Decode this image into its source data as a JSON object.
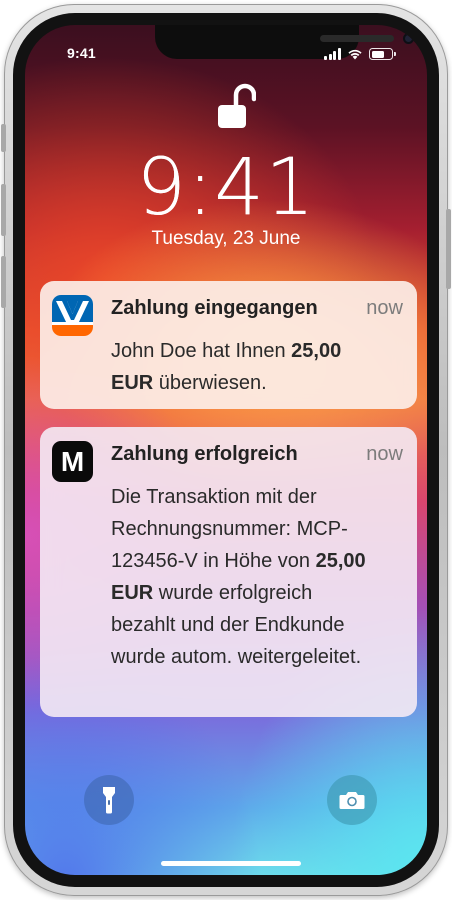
{
  "status_bar": {
    "time": "9:41",
    "icons": [
      "signal-icon",
      "wifi-icon",
      "battery-icon"
    ]
  },
  "lock_screen": {
    "lock_icon": "unlocked-padlock-icon",
    "clock": "9:41",
    "date": "Tuesday, 23 June"
  },
  "notifications": [
    {
      "app_icon": "volksbank-logo-icon",
      "title": "Zahlung eingegangen",
      "time": "now",
      "body_pre": "John Doe hat Ihnen",
      "body_bold": "25,00 EUR",
      "body_post": "überwiesen."
    },
    {
      "app_icon": "m-logo-icon",
      "app_icon_letter": "M",
      "title": "Zahlung erfolgreich",
      "time": "now",
      "body_pre": "Die Transaktion mit der Rechnungsnummer: MCP-123456-V in Höhe von",
      "body_bold": "25,00 EUR",
      "body_post": "wurde erfolgreich bezahlt und der Endkunde wurde autom. weitergeleitet."
    }
  ],
  "quick_actions": {
    "left": "flashlight-icon",
    "right": "camera-icon"
  },
  "colors": {
    "volksbank_blue": "#0066b3",
    "volksbank_orange": "#ff6600"
  }
}
